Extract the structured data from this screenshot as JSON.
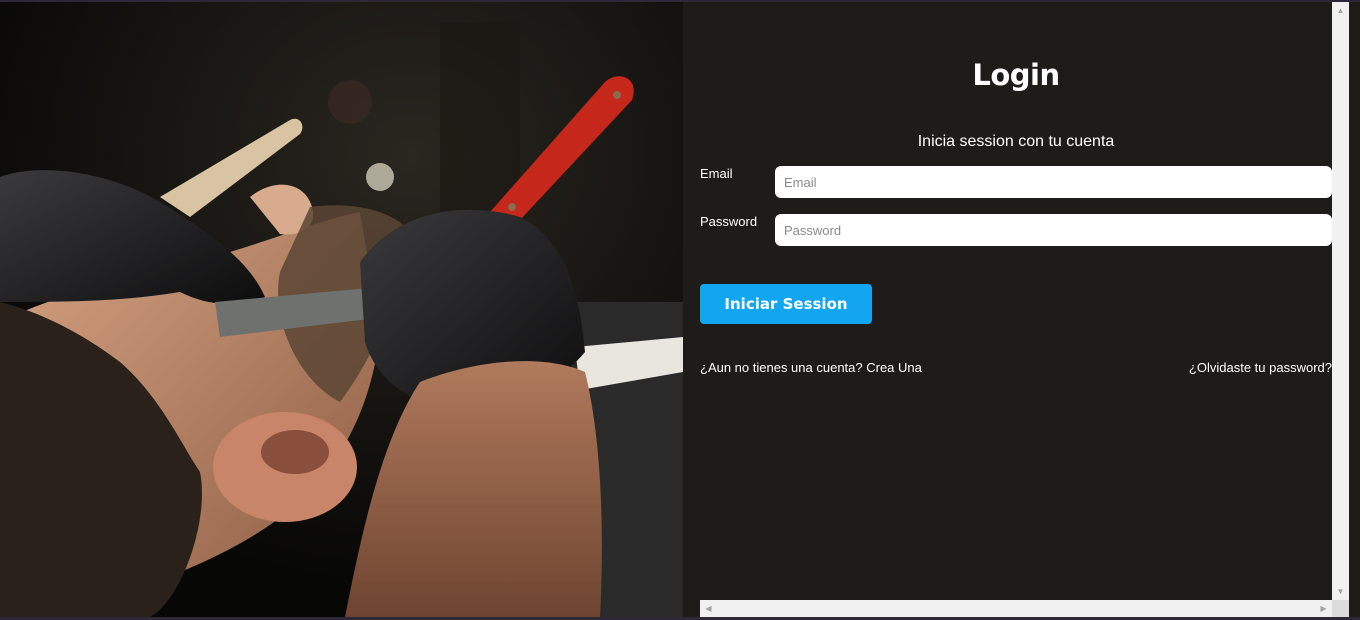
{
  "login": {
    "title": "Login",
    "subtitle": "Inicia session con tu cuenta",
    "email_label": "Email",
    "email_placeholder": "Email",
    "email_value": "",
    "password_label": "Password",
    "password_placeholder": "Password",
    "password_value": "",
    "submit_label": "Iniciar Session",
    "register_link": "¿Aun no tienes una cuenta? Crea Una",
    "forgot_link": "¿Olvidaste tu password?"
  },
  "colors": {
    "panel_background": "#1d1c18",
    "accent": "#12a5f0",
    "text": "#ffffff"
  },
  "icons": {
    "scroll_up": "triangle-up-icon",
    "scroll_down": "triangle-down-icon",
    "scroll_left": "triangle-left-icon",
    "scroll_right": "triangle-right-icon"
  }
}
